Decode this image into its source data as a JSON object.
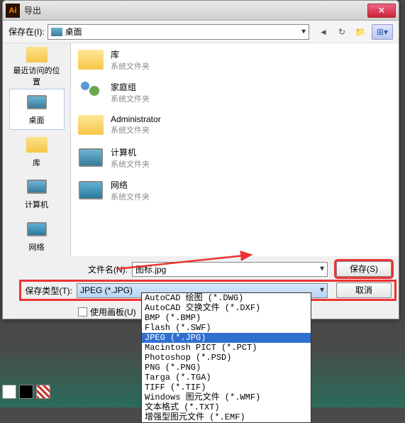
{
  "titlebar": {
    "app_icon": "Ai",
    "title": "导出"
  },
  "toolbar": {
    "save_in_label": "保存在(I):",
    "location": "桌面"
  },
  "places": [
    {
      "label": "最近访问的位置",
      "icon": "folder"
    },
    {
      "label": "桌面",
      "icon": "monitor",
      "selected": true
    },
    {
      "label": "库",
      "icon": "folder"
    },
    {
      "label": "计算机",
      "icon": "monitor"
    },
    {
      "label": "网络",
      "icon": "monitor"
    }
  ],
  "list": [
    {
      "title": "库",
      "sub": "系统文件夹",
      "icon": "folder"
    },
    {
      "title": "家庭组",
      "sub": "系统文件夹",
      "icon": "people"
    },
    {
      "title": "Administrator",
      "sub": "系统文件夹",
      "icon": "folder"
    },
    {
      "title": "计算机",
      "sub": "系统文件夹",
      "icon": "monitor"
    },
    {
      "title": "网络",
      "sub": "系统文件夹",
      "icon": "monitor"
    }
  ],
  "fields": {
    "filename_label": "文件名(N):",
    "filename_value": "图标.jpg",
    "filetype_label": "保存类型(T):",
    "filetype_value": "JPEG (*.JPG)",
    "save_btn": "保存(S)",
    "cancel_btn": "取消",
    "use_artboard": "使用画板(U)"
  },
  "dropdown": [
    "AutoCAD 绘图 (*.DWG)",
    "AutoCAD 交换文件 (*.DXF)",
    "BMP (*.BMP)",
    "Flash (*.SWF)",
    "JPEG (*.JPG)",
    "Macintosh PICT (*.PCT)",
    "Photoshop (*.PSD)",
    "PNG (*.PNG)",
    "Targa (*.TGA)",
    "TIFF (*.TIF)",
    "Windows 图元文件 (*.WMF)",
    "文本格式 (*.TXT)",
    "增强型图元文件 (*.EMF)"
  ]
}
